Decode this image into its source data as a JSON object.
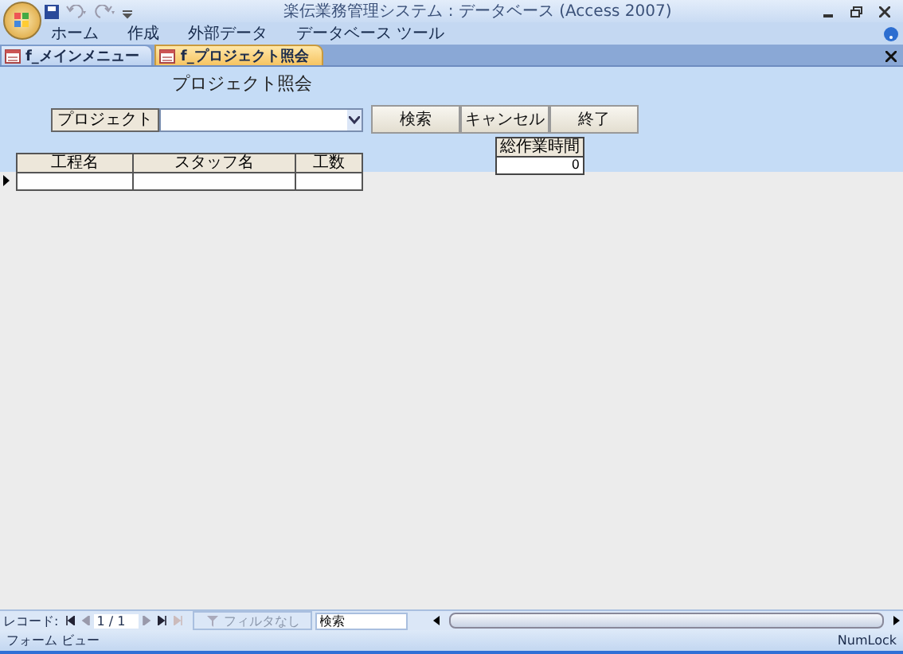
{
  "window": {
    "title": "楽伝業務管理システム : データベース (Access 2007)"
  },
  "ribbon": {
    "tabs": [
      "ホーム",
      "作成",
      "外部データ",
      "データベース ツール"
    ]
  },
  "doc_tabs": [
    {
      "label": "f_メインメニュー",
      "selected": false
    },
    {
      "label": "f_プロジェクト照会",
      "selected": true
    }
  ],
  "form": {
    "title": "プロジェクト照会",
    "project_label": "プロジェクト",
    "buttons": [
      "検索",
      "キャンセル",
      "終了"
    ],
    "total_label": "総作業時間",
    "total_value": "0"
  },
  "table": {
    "columns": [
      "工程名",
      "スタッフ名",
      "工数"
    ]
  },
  "record_nav": {
    "label": "レコード:",
    "position": "1 / 1",
    "filter": "フィルタなし",
    "search": {
      "placeholder": "検索"
    }
  },
  "status_bar": {
    "left": "フォーム ビュー",
    "right": "NumLock"
  }
}
